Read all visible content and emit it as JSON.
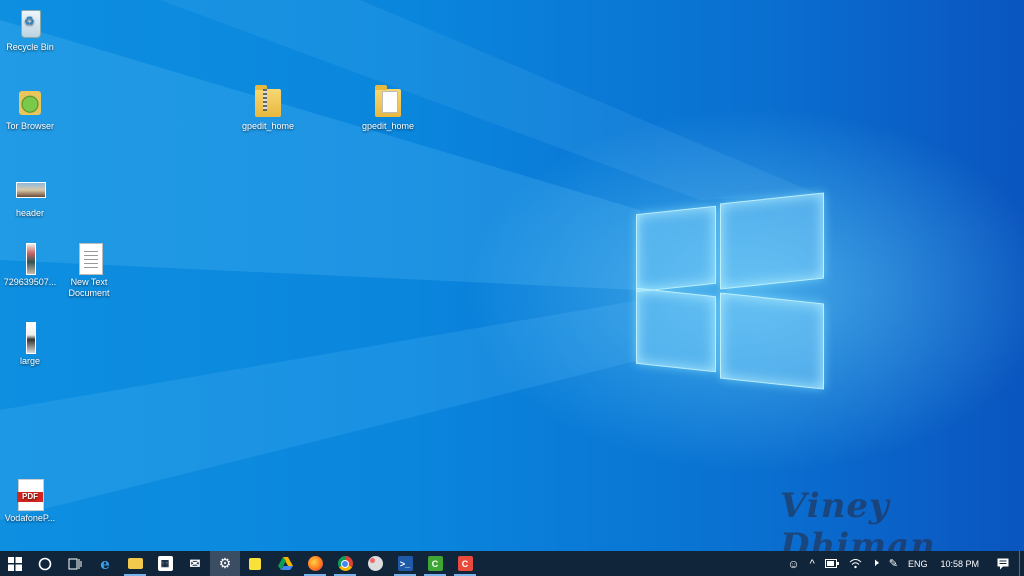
{
  "desktop": {
    "icons": [
      {
        "label": "Recycle Bin"
      },
      {
        "label": "Tor Browser"
      },
      {
        "label": "gpedit_home"
      },
      {
        "label": "gpedit_home"
      },
      {
        "label": "header"
      },
      {
        "label": "729639507..."
      },
      {
        "label": "New Text Document"
      },
      {
        "label": "large"
      },
      {
        "label": "VodafoneP..."
      }
    ],
    "watermark": "Viney Dhiman"
  },
  "taskbar": {
    "apps": [
      {
        "icon": "task-view-icon"
      },
      {
        "icon": "edge-icon"
      },
      {
        "icon": "file-explorer-icon"
      },
      {
        "icon": "store-icon"
      },
      {
        "icon": "mail-icon"
      },
      {
        "icon": "settings-icon"
      },
      {
        "icon": "sticky-notes-icon"
      },
      {
        "icon": "drive-icon"
      },
      {
        "icon": "firefox-icon"
      },
      {
        "icon": "chrome-icon"
      },
      {
        "icon": "paint-icon"
      },
      {
        "icon": "powershell-icon"
      },
      {
        "icon": "camtasia-icon"
      },
      {
        "icon": "camtasia-recorder-icon"
      }
    ],
    "tray": {
      "language": "ENG",
      "time": "10:58 PM"
    }
  }
}
